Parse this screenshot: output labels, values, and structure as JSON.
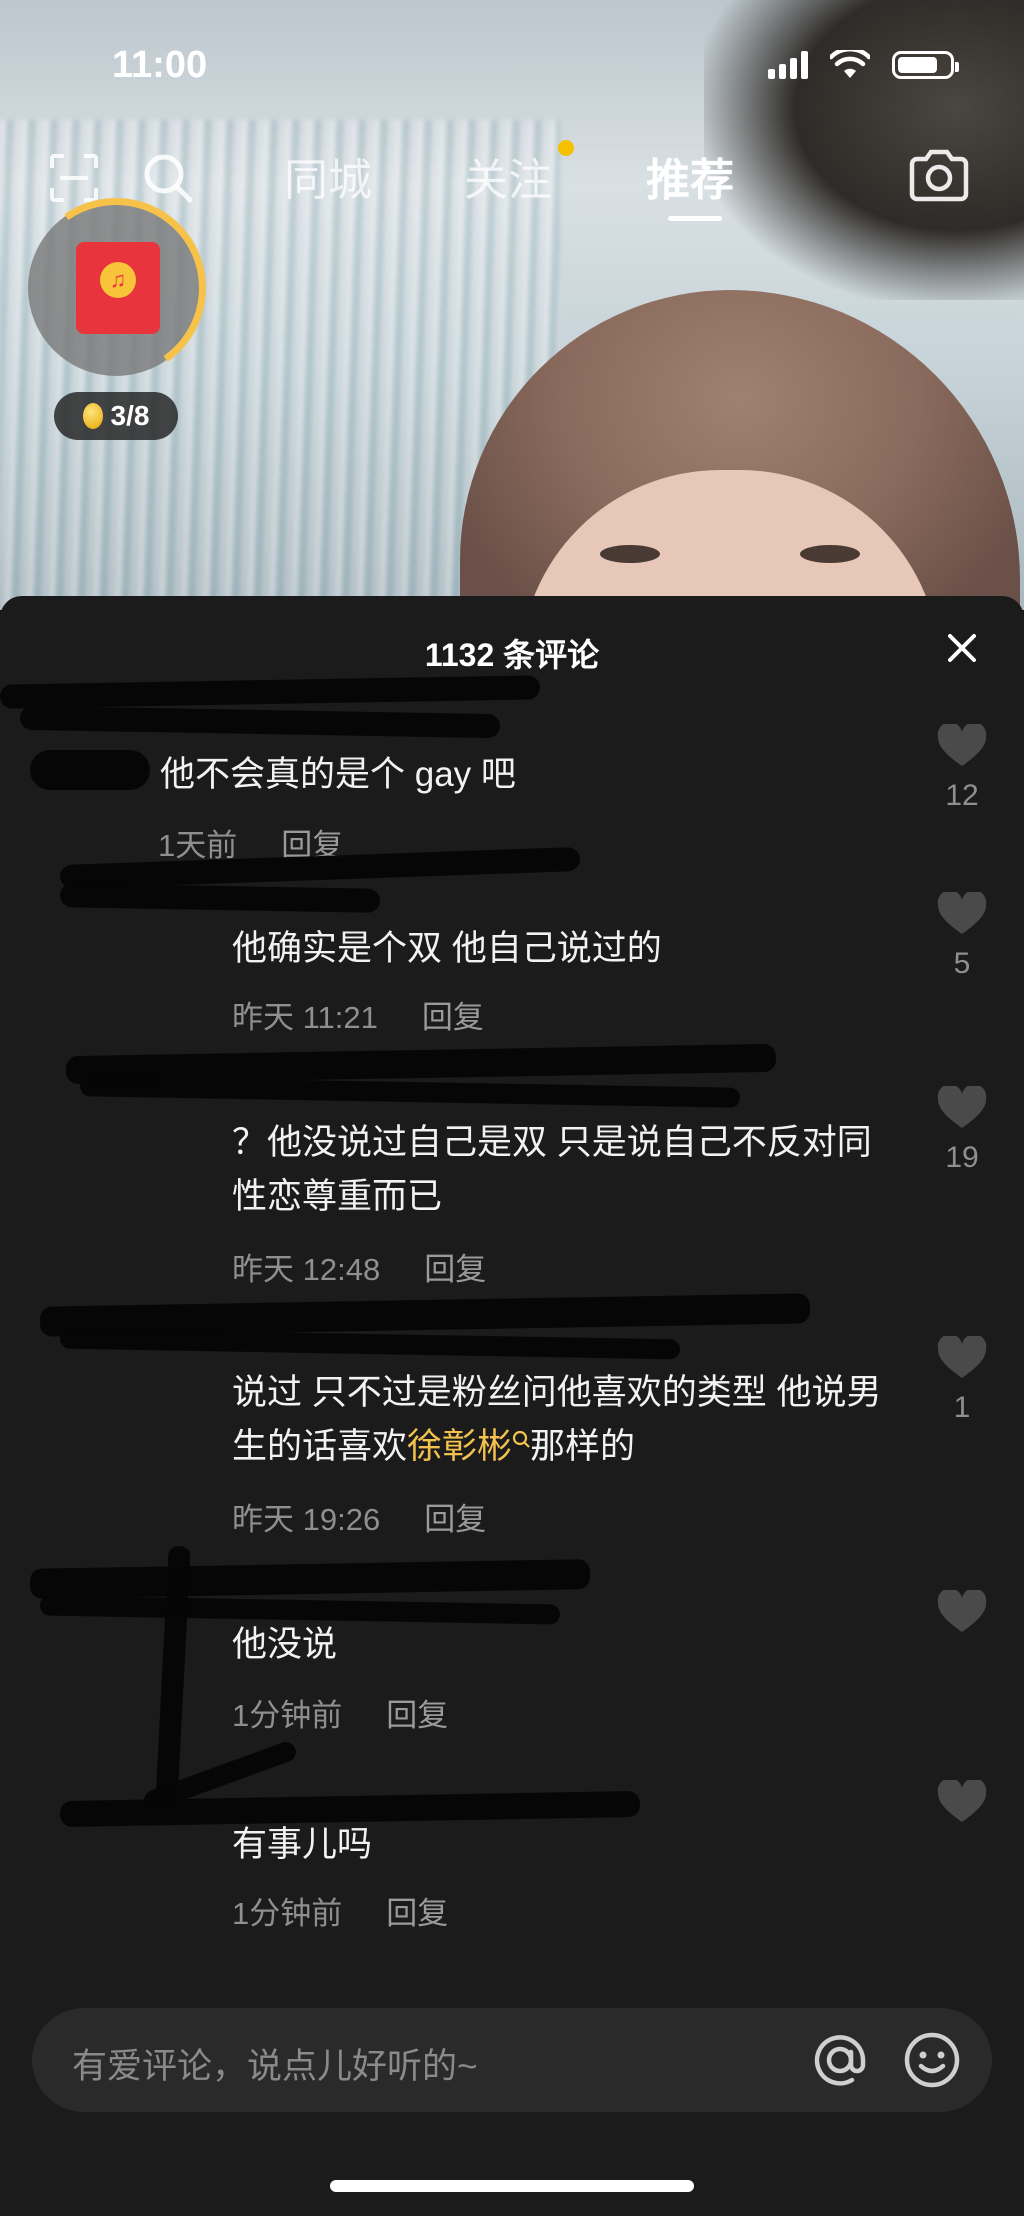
{
  "status_bar": {
    "time": "11:00"
  },
  "top_nav": {
    "tabs": [
      {
        "label": "同城"
      },
      {
        "label": "关注"
      },
      {
        "label": "推荐"
      }
    ],
    "active_tab": "推荐",
    "notification_dot_color": "#f6c000"
  },
  "reward": {
    "progress_label": "3/8",
    "ring_color": "#f6c24a",
    "envelope_color": "#e8343c"
  },
  "comments_panel": {
    "title": "1132 条评论",
    "comments": [
      {
        "text": "他不会真的是个 gay 吧",
        "time": "1天前",
        "reply": "回复",
        "likes": "12"
      },
      {
        "text": "他确实是个双 他自己说过的",
        "time": "昨天 11:21",
        "reply": "回复",
        "likes": "5"
      },
      {
        "text": "？他没说过自己是双 只是说自己不反对同性恋尊重而已",
        "time": "昨天 12:48",
        "reply": "回复",
        "likes": "19"
      },
      {
        "text_before": "说过 只不过是粉丝问他喜欢的类型 他说男生的话喜欢",
        "highlight": "徐彰彬",
        "text_after": "那样的",
        "time": "昨天 19:26",
        "reply": "回复",
        "likes": "1"
      },
      {
        "text": "他没说",
        "time": "1分钟前",
        "reply": "回复",
        "likes": ""
      },
      {
        "text": "有事儿吗",
        "time": "1分钟前",
        "reply": "回复",
        "likes": ""
      }
    ]
  },
  "input": {
    "placeholder": "有爱评论，说点儿好听的~"
  }
}
